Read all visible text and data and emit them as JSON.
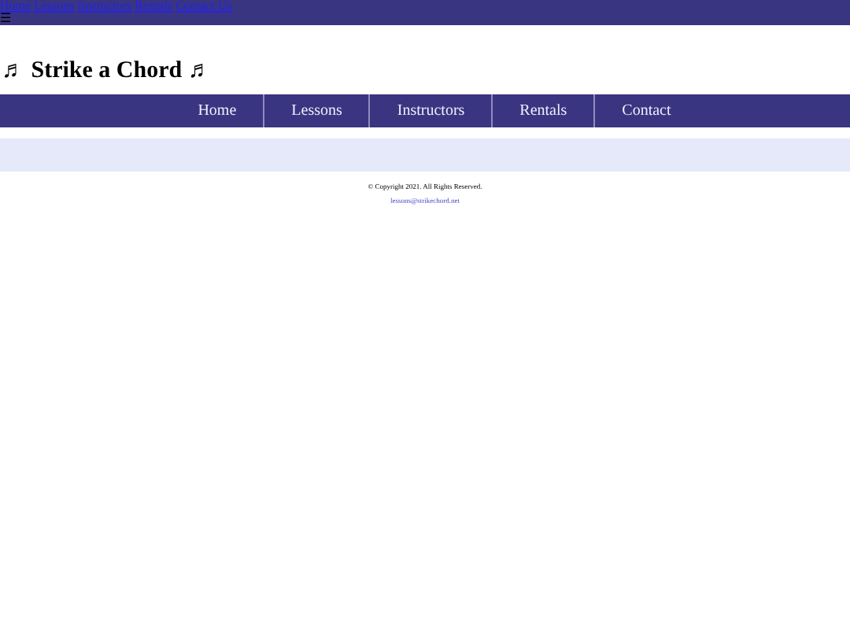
{
  "top_links": [
    "Home",
    "Lessons",
    "Instructors",
    "Rentals",
    "Contact Us"
  ],
  "menu_toggle": "☰",
  "site_title": "♬ Strike a Chord ♬",
  "nav": [
    "Home",
    "Lessons",
    "Instructors",
    "Rentals",
    "Contact"
  ],
  "footer": {
    "copyright": "© Copyright 2021. All Rights Reserved.",
    "email": "lessons@strikechord.net"
  }
}
